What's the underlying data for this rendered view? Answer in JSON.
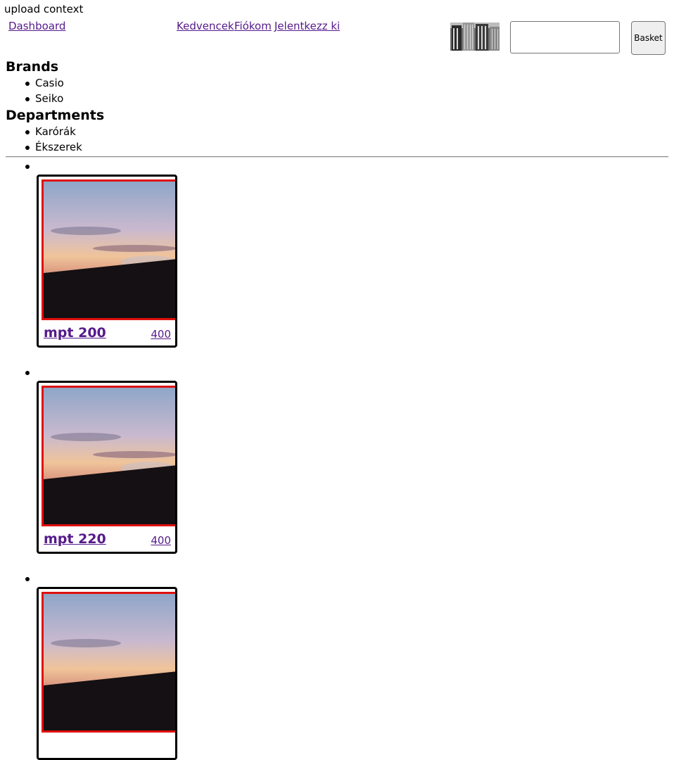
{
  "context_text": "upload context",
  "nav": {
    "dashboard": "Dashboard",
    "favorites": "Kedvencek",
    "account": "Fiókom",
    "logout": "Jelentkezz ki"
  },
  "search": {
    "value": "",
    "placeholder": ""
  },
  "basket_label": "Basket",
  "brands": {
    "heading": "Brands",
    "items": [
      "Casio",
      "Seiko"
    ]
  },
  "departments": {
    "heading": "Departments",
    "items": [
      "Karórák",
      "Ékszerek"
    ]
  },
  "products": [
    {
      "name": "mpt 200",
      "price": "400"
    },
    {
      "name": "mpt 220",
      "price": "400"
    },
    {
      "name": "",
      "price": ""
    }
  ],
  "colors": {
    "link": "#551a8b",
    "image_border": "#e0110f"
  }
}
